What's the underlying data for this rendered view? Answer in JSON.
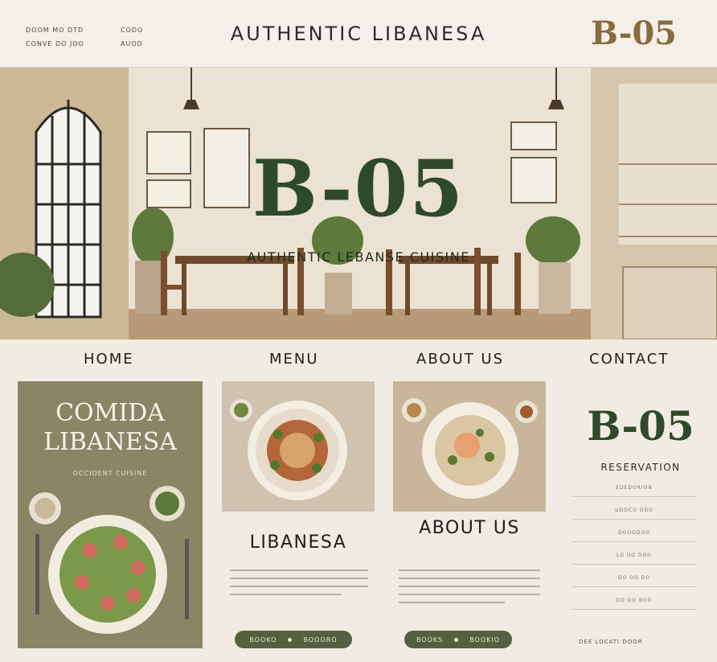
{
  "topbar": {
    "left_text_1": "DOOM  MO  DTD",
    "left_text_2": "CONVE   DO  JOO",
    "mid_text_1": "CODO",
    "mid_text_2": "AUOD",
    "title": "AUTHENTIC LIBANESA",
    "brand": "B-05"
  },
  "hero": {
    "title": "B-05",
    "subtitle": "AUTHENTIC LEBANSE CUISINE"
  },
  "nav": {
    "items": [
      "HOME",
      "MENU",
      "ABOUT US",
      "CONTACT"
    ]
  },
  "card_a": {
    "title_1": "COMIDA",
    "title_2": "LIBANESA",
    "subtitle": "OCCIDENT CUISINE"
  },
  "card_b": {
    "title": "LIBANESA",
    "button_left": "BOOKO",
    "button_right": "BOOORO"
  },
  "card_c": {
    "title": "ABOUT US",
    "button_left": "BOOKS",
    "button_right": "BOOKIO"
  },
  "reservation": {
    "brand": "B-05",
    "subtitle": "RESERVATION",
    "rows": [
      "EDEDORION",
      "UDOCO   ODO",
      "DOOODOO",
      "LO  UO  DOO",
      "DO   OO   DO",
      "OD   DO   BOO"
    ],
    "footer": "DEE  LOCATI   DOOR"
  },
  "colors": {
    "accent_green": "#2f4a2a",
    "brand_brown": "#8a6a3f",
    "pill_green": "#55603f",
    "card_olive": "#8b8566",
    "background": "#f1ece3"
  }
}
